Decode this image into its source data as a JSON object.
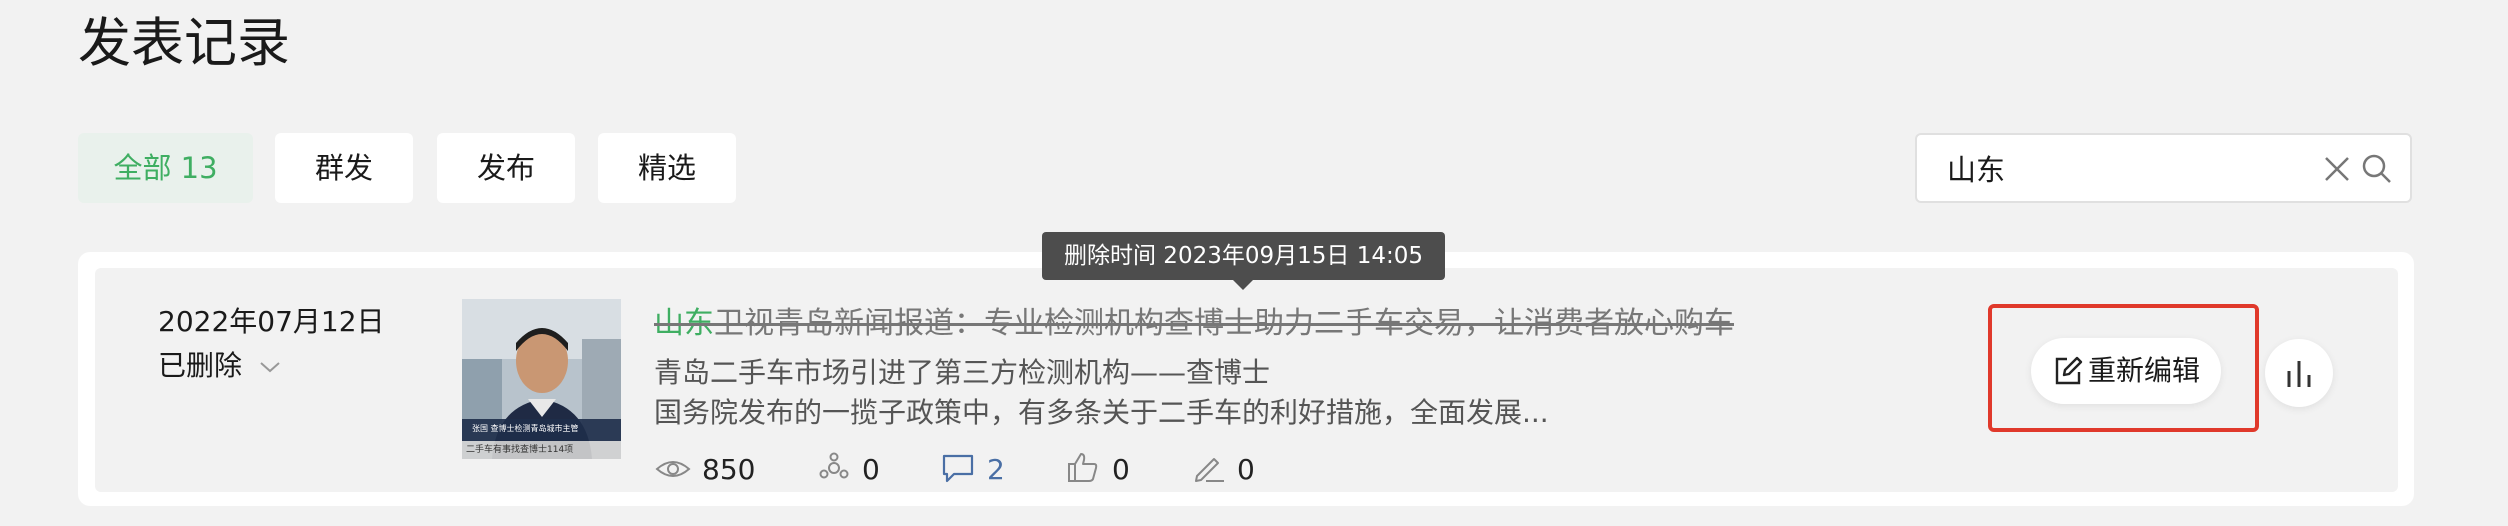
{
  "page": {
    "title": "发表记录"
  },
  "filters": [
    {
      "label": "全部 13",
      "active": true
    },
    {
      "label": "群发",
      "active": false
    },
    {
      "label": "发布",
      "active": false
    },
    {
      "label": "精选",
      "active": false
    }
  ],
  "search": {
    "value": "山东",
    "clear_icon": "close-icon",
    "search_icon": "search-icon"
  },
  "record": {
    "tooltip": "删除时间 2023年09月15日 14:05",
    "date": "2022年07月12日",
    "status": "已删除",
    "thumbnail_caption": "张国  查博士检测青岛城市主管",
    "thumbnail_footer": "二手车有事找查博士114项",
    "title_highlight": "山东",
    "title_rest": "卫视青岛新闻报道：专业检测机构查博士助力二手车交易，让消费者放心购车",
    "summary_1": "青岛二手车市场引进了第三方检测机构——查博士",
    "summary_2": "国务院发布的一揽子政策中，有多条关于二手车的利好措施，全面发展...",
    "stats": {
      "views": "850",
      "shares": "0",
      "comments": "2",
      "likes": "0",
      "edits": "0"
    },
    "reedit_label": "重新编辑"
  },
  "colors": {
    "accent_green": "#3fae62",
    "comment_blue": "#4a6fa5",
    "highlight_red": "#e0392b"
  }
}
